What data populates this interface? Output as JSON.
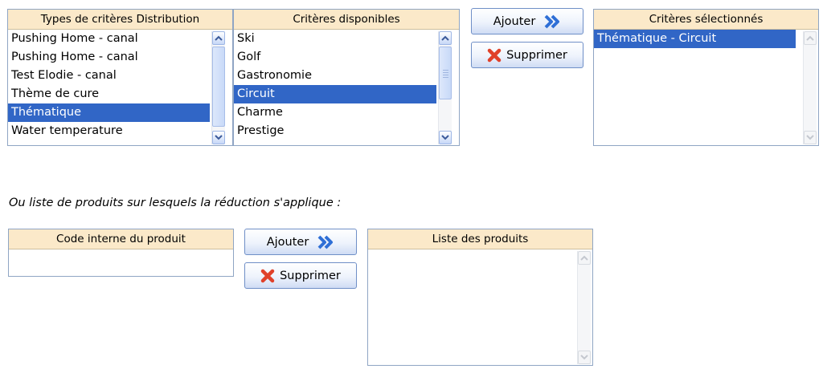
{
  "distribution_types": {
    "header": "Types de critères Distribution",
    "items": [
      "Pushing Home - canal",
      "Pushing Home - canal",
      "Test Elodie - canal",
      "Thème de cure",
      "Thématique",
      "Water temperature"
    ],
    "selected_index": 4
  },
  "available_criteria": {
    "header": "Critères disponibles",
    "items": [
      "Ski",
      "Golf",
      "Gastronomie",
      "Circuit",
      "Charme",
      "Prestige"
    ],
    "selected_index": 3
  },
  "criteria_actions": {
    "add_label": "Ajouter",
    "remove_label": "Supprimer"
  },
  "selected_criteria": {
    "header": "Critères sélectionnés",
    "items": [
      "Thématique - Circuit"
    ],
    "selected_index": 0
  },
  "product_section": {
    "intro": "Ou liste de produits sur lesquels la réduction s'applique :",
    "code_header": "Code interne du produit",
    "code_value": "",
    "add_label": "Ajouter",
    "remove_label": "Supprimer",
    "list_header": "Liste des produits",
    "list_items": []
  },
  "colors": {
    "header_bg": "#fbe9c9",
    "selection": "#3166c6",
    "border": "#8fa5c4",
    "add_arrow": "#2f6fd6",
    "remove_x": "#e0412a"
  },
  "icons": {
    "add": "double-chevron-right-icon",
    "remove": "red-x-icon",
    "scroll_up": "chevron-up-icon",
    "scroll_down": "chevron-down-icon"
  }
}
